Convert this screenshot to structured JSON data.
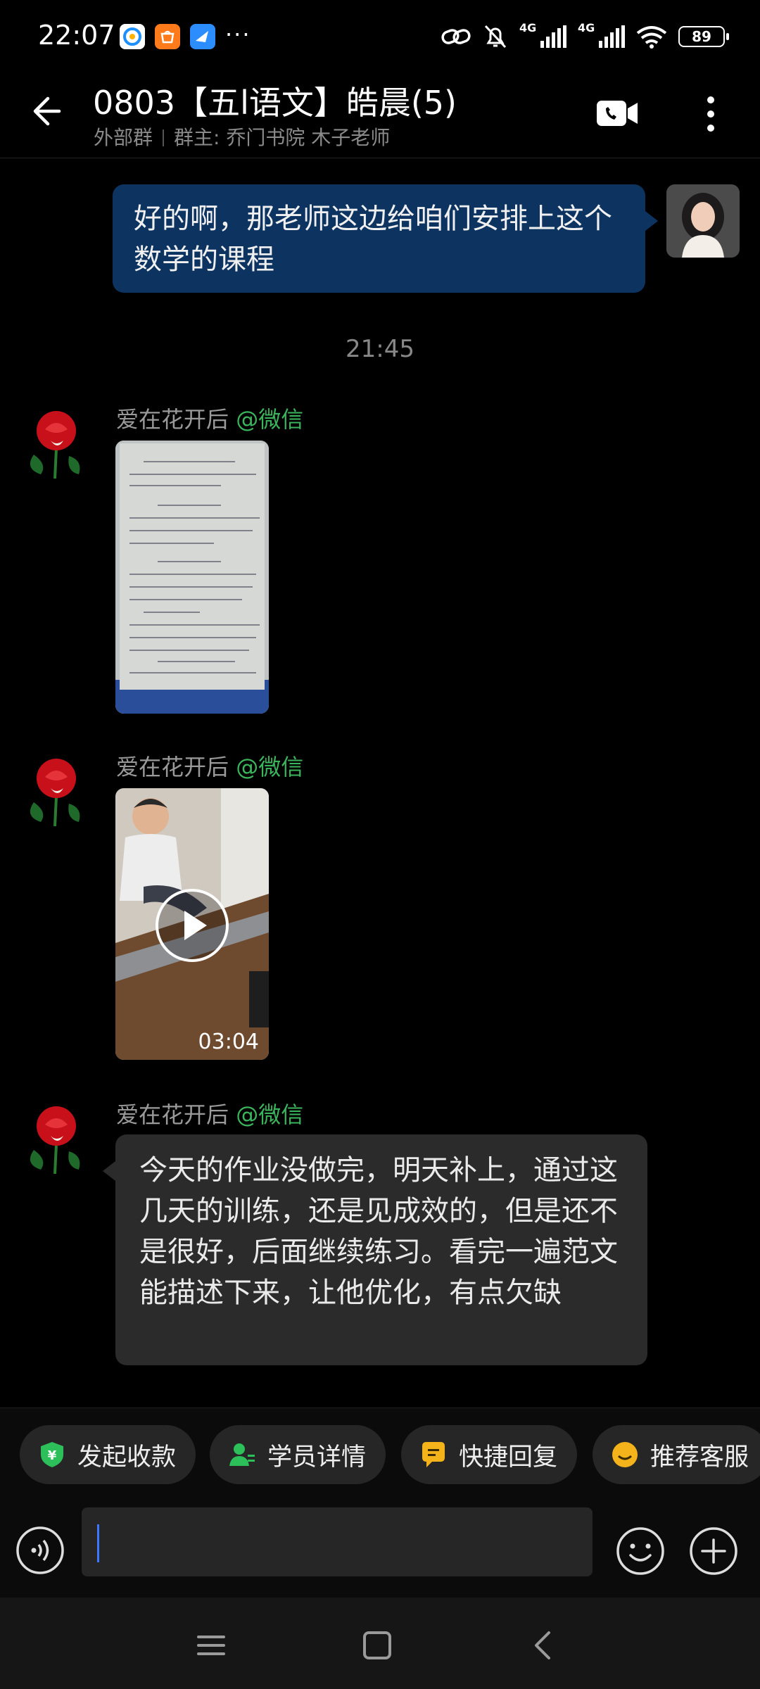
{
  "status_bar": {
    "time": "22:07",
    "net1": "4G",
    "net2": "4G",
    "battery": "89",
    "more": "···",
    "app_icons": [
      "qq-browser-icon",
      "taobao-icon",
      "feishu-icon"
    ],
    "right_icons": [
      "link-icon",
      "mute-bell-icon",
      "signal-icon",
      "signal-icon",
      "wifi-icon",
      "battery-icon"
    ]
  },
  "header": {
    "title": "0803【五l语文】皓晨(5)",
    "group_type": "外部群",
    "owner": "群主: 乔门书院 木子老师",
    "icons": [
      "back-arrow-icon",
      "video-call-icon",
      "more-vertical-icon"
    ]
  },
  "messages": {
    "m1": {
      "text": "好的啊，那老师这边给咱们安排上这个数学的课程"
    },
    "time": "21:45",
    "m2": {
      "sender": "爱在花开后",
      "source": "@微信"
    },
    "m3": {
      "sender": "爱在花开后",
      "source": "@微信",
      "duration": "03:04"
    },
    "m4": {
      "sender": "爱在花开后",
      "source": "@微信",
      "text": "今天的作业没做完，明天补上，通过这几天的训练，还是见成效的，但是还不是很好，后面继续练习。看完一遍范文能描述下来，让他优化，有点欠缺"
    }
  },
  "quick_actions": [
    {
      "label": "发起收款",
      "icon": "payment-shield-icon"
    },
    {
      "label": "学员详情",
      "icon": "student-icon"
    },
    {
      "label": "快捷回复",
      "icon": "quick-reply-icon"
    },
    {
      "label": "推荐客服",
      "icon": "recommend-service-icon"
    }
  ],
  "input": {
    "value": ""
  },
  "colors": {
    "background": "#000000",
    "my_bubble": "#0d3461",
    "their_bubble": "#2b2b2b",
    "source_green": "#3bb55b",
    "chip_green": "#2cbf5a",
    "chip_yellow": "#f5b31b",
    "caret_blue": "#3c78ff"
  }
}
